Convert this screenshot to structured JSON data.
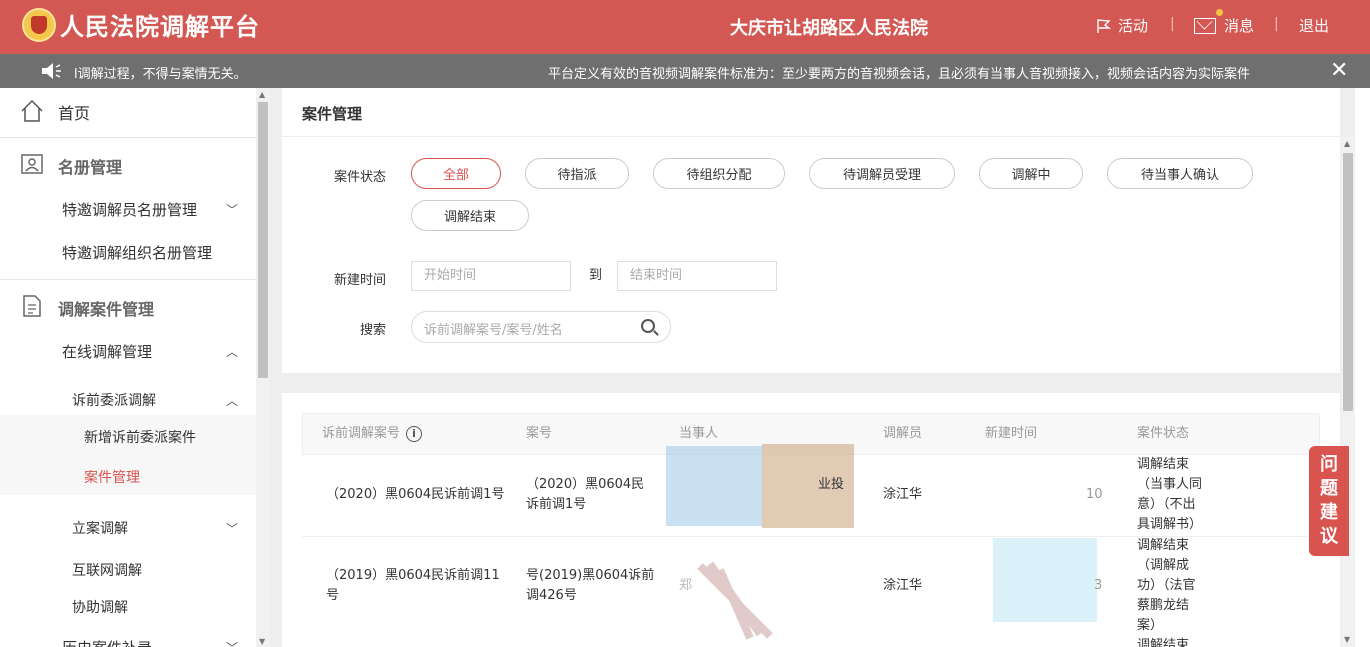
{
  "header": {
    "title": "人民法院调解平台",
    "court": "大庆市让胡路区人民法院",
    "activity": "活动",
    "messages": "消息",
    "logout": "退出",
    "separator": "|"
  },
  "notice": {
    "left": "l调解过程，不得与案情无关。",
    "right": "平台定义有效的音视频调解案件标准为：至少要两方的音视频会话，且必须有当事人音视频接入，视频会话内容为实际案件",
    "close": "✕"
  },
  "sidebar": {
    "home": "首页",
    "roster": "名册管理",
    "roster_mediators": "特邀调解员名册管理",
    "roster_orgs": "特邀调解组织名册管理",
    "cases": "调解案件管理",
    "online": "在线调解管理",
    "pre_lit": "诉前委派调解",
    "add_pre_lit": "新增诉前委派案件",
    "case_mgmt": "案件管理",
    "filing": "立案调解",
    "internet": "互联网调解",
    "assist": "协助调解",
    "history": "历史案件补录"
  },
  "page": {
    "title": "案件管理",
    "status_label": "案件状态",
    "status_options": [
      "全部",
      "待指派",
      "待组织分配",
      "待调解员受理",
      "调解中",
      "待当事人确认",
      "调解结束"
    ],
    "date_label": "新建时间",
    "date_to": "到",
    "date_start_ph": "开始时间",
    "date_end_ph": "结束时间",
    "search_label": "搜索",
    "search_ph": "诉前调解案号/案号/姓名"
  },
  "table": {
    "headers": [
      "诉前调解案号",
      "案号",
      "当事人",
      "调解员",
      "新建时间",
      "案件状态"
    ],
    "rows": [
      {
        "pre_no": "（2020）黑0604民诉前调1号",
        "case_no_1": "（2020）黑0604民",
        "case_no_2": "诉前调1号",
        "party": "业投",
        "mediator": "涂江华",
        "created": "10",
        "status": [
          "调解结束",
          "（当事人同",
          "意）（不出",
          "具调解书）"
        ]
      },
      {
        "pre_no_1": "（2019）黑0604民诉前调11",
        "pre_no_2": "号",
        "case_no_1": "号(2019)黑0604诉前",
        "case_no_2": "调426号",
        "party": "郑",
        "mediator": "涂江华",
        "created": "3",
        "status": [
          "调解结束",
          "（调解成",
          "功）（法官",
          "蔡鹏龙结",
          "案）",
          "调解结束"
        ]
      }
    ]
  },
  "feedback": [
    "问",
    "题",
    "建",
    "议"
  ],
  "colors": {
    "brand": "#d35752",
    "notice_bg": "#6f6f6f",
    "accent": "#d9534f"
  }
}
